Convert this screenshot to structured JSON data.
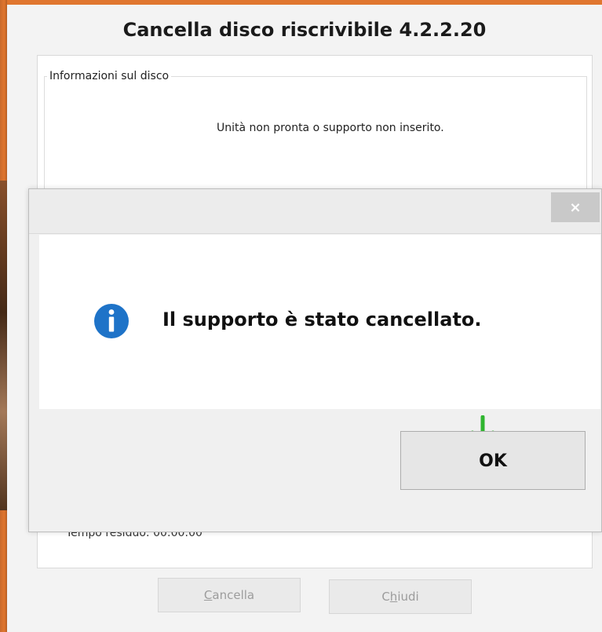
{
  "main_window": {
    "title": "Cancella disco riscrivibile 4.2.2.20",
    "group_label": "Informazioni sul disco",
    "drive_status": "Unità non pronta o supporto non inserito.",
    "partial_row": "Tempo residuo: 00:00:00",
    "buttons": {
      "cancel_label_mnemonic": "C",
      "cancel_label_rest": "ancella",
      "close_label_mnemonic": "h",
      "close_label_first": "C",
      "close_label_rest": "iudi"
    }
  },
  "dialog": {
    "close_glyph": "×",
    "icon": "info-icon",
    "message": "Il supporto è stato cancellato.",
    "ok_label": "OK",
    "annotation": "green-down-arrow-icon"
  },
  "colors": {
    "info_blue": "#1e73c8",
    "arrow_green": "#2fb52f",
    "window_accent": "#e0762f"
  }
}
